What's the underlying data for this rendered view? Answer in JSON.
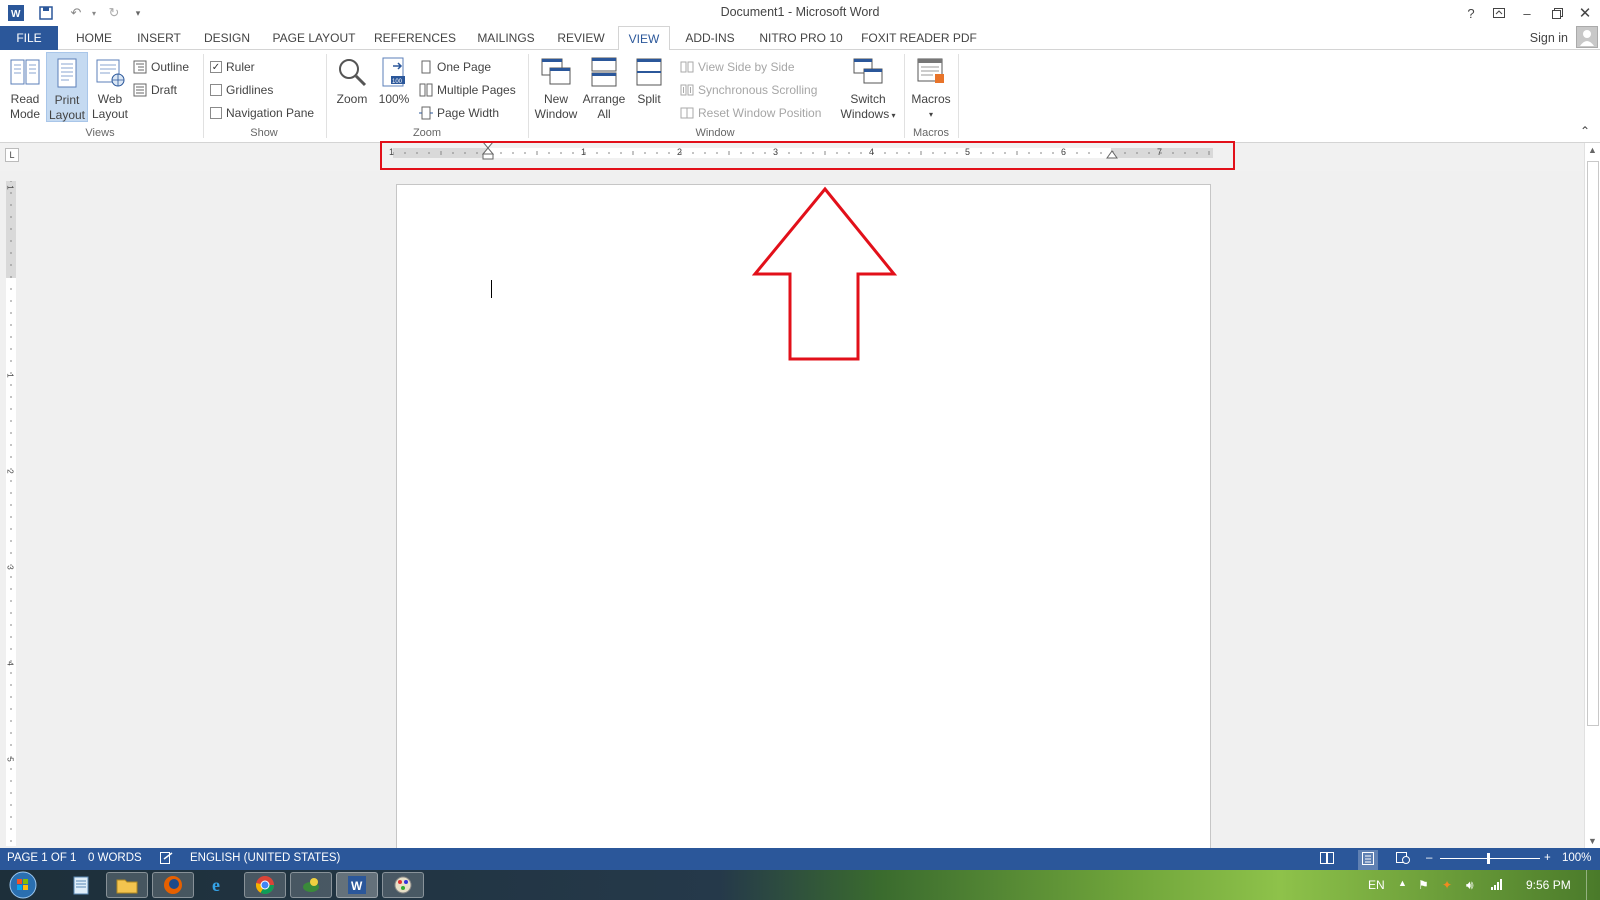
{
  "window": {
    "title": "Document1 - Microsoft Word"
  },
  "tabs": [
    {
      "label": "FILE"
    },
    {
      "label": "HOME"
    },
    {
      "label": "INSERT"
    },
    {
      "label": "DESIGN"
    },
    {
      "label": "PAGE LAYOUT"
    },
    {
      "label": "REFERENCES"
    },
    {
      "label": "MAILINGS"
    },
    {
      "label": "REVIEW"
    },
    {
      "label": "VIEW"
    },
    {
      "label": "ADD-INS"
    },
    {
      "label": "NITRO PRO 10"
    },
    {
      "label": "FOXIT READER PDF"
    }
  ],
  "account": {
    "signin": "Sign in"
  },
  "ribbon": {
    "views": {
      "label": "Views",
      "read_mode": [
        "Read",
        "Mode"
      ],
      "print_layout": [
        "Print",
        "Layout"
      ],
      "web_layout": [
        "Web",
        "Layout"
      ],
      "outline": "Outline",
      "draft": "Draft"
    },
    "show": {
      "label": "Show",
      "ruler": "Ruler",
      "ruler_checked": true,
      "gridlines": "Gridlines",
      "navigation_pane": "Navigation Pane"
    },
    "zoom": {
      "label": "Zoom",
      "zoom": "Zoom",
      "hundred": "100%",
      "one_page": "One Page",
      "multiple_pages": "Multiple Pages",
      "page_width": "Page Width"
    },
    "window": {
      "label": "Window",
      "new_window": [
        "New",
        "Window"
      ],
      "arrange_all": [
        "Arrange",
        "All"
      ],
      "split": "Split",
      "view_side_by_side": "View Side by Side",
      "synchronous_scrolling": "Synchronous Scrolling",
      "reset_window_position": "Reset Window Position",
      "switch_windows": [
        "Switch",
        "Windows"
      ]
    },
    "macros": {
      "label": "Macros",
      "macros": "Macros"
    }
  },
  "ruler": {
    "numbers": [
      "1",
      "1",
      "2",
      "3",
      "4",
      "5",
      "6",
      "7"
    ],
    "vnumbers": [
      "1",
      "1",
      "2",
      "3",
      "4",
      "5"
    ]
  },
  "statusbar": {
    "page": "PAGE 1 OF 1",
    "words": "0 WORDS",
    "language": "ENGLISH (UNITED STATES)",
    "zoom": "100%"
  },
  "taskbar": {
    "lang": "EN",
    "time": "9:56 PM"
  },
  "colors": {
    "accent": "#2b579a",
    "highlight": "#e2101a"
  }
}
